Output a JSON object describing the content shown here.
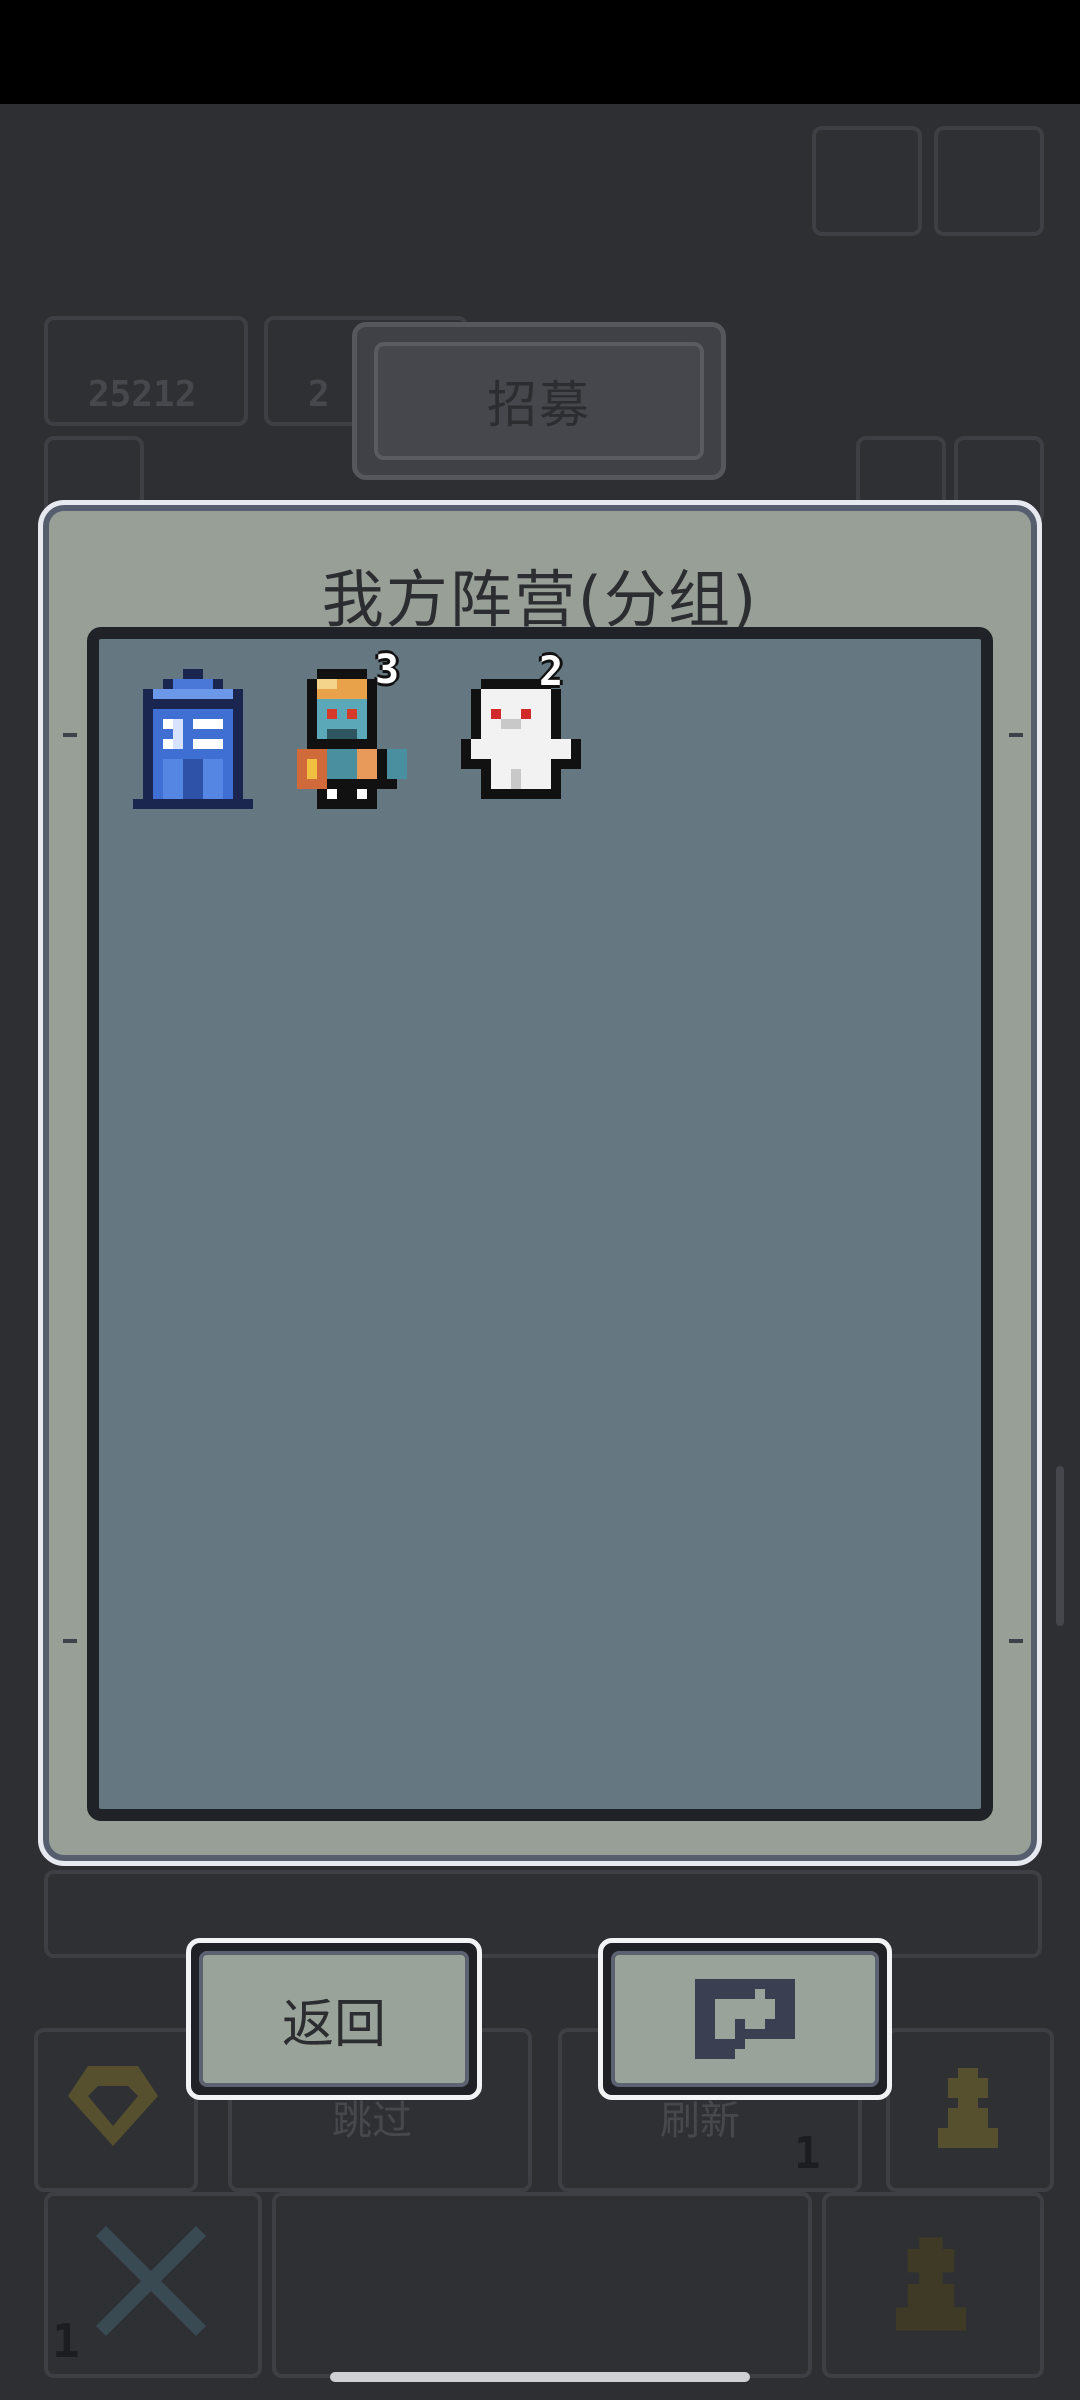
{
  "screen": {
    "recruit_tab_label": "招募",
    "background_counters": {
      "coins": "25212",
      "gems": "2"
    },
    "background_buttons": {
      "skip_label": "跳过",
      "refresh_label": "刷新",
      "refresh_count": "1",
      "dismiss_count": "1"
    }
  },
  "panel": {
    "title": "我方阵营(分组)",
    "units": [
      {
        "name": "blue-phone-booth",
        "icon": "phone-booth-icon",
        "level": ""
      },
      {
        "name": "zombie-engineer",
        "icon": "zombie-engineer-icon",
        "level": "3"
      },
      {
        "name": "white-ghost",
        "icon": "ghost-icon",
        "level": "2"
      }
    ]
  },
  "buttons": {
    "back_label": "返回",
    "swap_icon": "swap-arrows-icon"
  },
  "colors": {
    "panel_frame": "#979f97",
    "panel_inner": "#657780",
    "button_face": "#9aa39a",
    "overlay_bg": "#2e2f33"
  }
}
